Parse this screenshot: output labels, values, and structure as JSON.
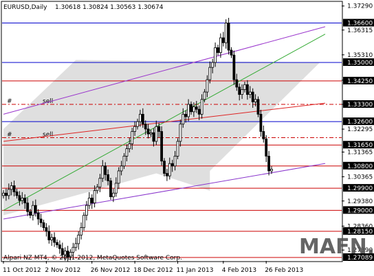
{
  "header": {
    "symbol_label": "EURUSD,Daily",
    "ohlc_label": "1.30618 1.30824 1.30563 1.30674"
  },
  "footer": {
    "copyright": "Alpari NZ MT4, © 2001-2012, MetaQuotes Software Corp.",
    "watermark": "MAFN.RU"
  },
  "colors": {
    "background": "#ffffff",
    "candles": "#000000",
    "channel_fill": "#d9d9d9",
    "level_blue": "#0000cc",
    "level_red": "#cc0000",
    "level_label_bg": "#000000",
    "resistance_purple": "#9933cc",
    "support_purple": "#8833cc",
    "trend_green": "#33aa33",
    "trend_red": "#dd2222",
    "watermark": "#555555"
  },
  "chart_data": {
    "type": "candlestick",
    "title": "EURUSD,Daily",
    "ylim": [
      1.2695,
      1.3745
    ],
    "y_ticks": [
      "1.37290",
      "1.36315",
      "1.35310",
      "1.34280",
      "1.33300",
      "1.32295",
      "1.31365",
      "1.30365",
      "1.29380",
      "1.28360",
      "1.27390"
    ],
    "x_ticks": [
      "11 Oct 2012",
      "2 Nov 2012",
      "26 Nov 2012",
      "18 Dec 2012",
      "11 Jan 2013",
      "4 Feb 2013",
      "26 Feb 2013"
    ],
    "x_tick_bars": [
      0,
      16,
      33,
      49,
      65,
      82,
      98
    ],
    "levels": [
      {
        "value": 1.366,
        "label": "1.36600",
        "color": "#0000cc",
        "style": "solid"
      },
      {
        "value": 1.35,
        "label": "1.35000",
        "color": "#0000cc",
        "style": "solid"
      },
      {
        "value": 1.3425,
        "label": "1.34250",
        "color": "#cc0000",
        "style": "solid"
      },
      {
        "value": 1.333,
        "label": "1.33300",
        "color": "#cc0000",
        "style": "dashdot",
        "marker": "#",
        "note": "sell"
      },
      {
        "value": 1.326,
        "label": "1.32600",
        "color": "#0000cc",
        "style": "solid"
      },
      {
        "value": 1.3195,
        "label": "",
        "color": "#cc0000",
        "style": "dashdot",
        "marker": "#",
        "note": "sell"
      },
      {
        "value": 1.3165,
        "label": "1.31650",
        "color": "#cc0000",
        "style": "solid"
      },
      {
        "value": 1.308,
        "label": "1.30800",
        "color": "#cc0000",
        "style": "solid"
      },
      {
        "value": 1.299,
        "label": "1.29900",
        "color": "#cc0000",
        "style": "solid"
      },
      {
        "value": 1.29,
        "label": "1.29000",
        "color": "#cc0000",
        "style": "solid"
      },
      {
        "value": 1.2815,
        "label": "1.28150",
        "color": "#cc0000",
        "style": "solid"
      },
      {
        "value": 1.27089,
        "label": "1.27089",
        "color": "#cc0000",
        "style": "solid"
      }
    ],
    "trendlines": [
      {
        "name": "channel-upper",
        "from": [
          0,
          1.329
        ],
        "to": [
          120,
          1.3645
        ],
        "color": "#9933cc"
      },
      {
        "name": "channel-lower",
        "from": [
          0,
          1.2865
        ],
        "to": [
          120,
          1.309
        ],
        "color": "#8833cc"
      },
      {
        "name": "green-trend",
        "from": [
          0,
          1.29
        ],
        "to": [
          120,
          1.3615
        ],
        "color": "#33aa33"
      },
      {
        "name": "red-trend",
        "from": [
          0,
          1.318
        ],
        "to": [
          120,
          1.3335
        ],
        "color": "#dd2222"
      }
    ],
    "channel_band": [
      [
        0,
        1.288
      ],
      [
        0,
        1.323
      ],
      [
        27,
        1.351
      ],
      [
        118,
        1.35
      ],
      [
        77,
        1.306
      ],
      [
        77,
        1.298
      ],
      [
        57,
        1.305
      ]
    ],
    "closes": [
      1.297,
      1.296,
      1.2985,
      1.3,
      1.2975,
      1.296,
      1.294,
      1.295,
      1.293,
      1.2895,
      1.288,
      1.292,
      1.289,
      1.2865,
      1.285,
      1.283,
      1.2815,
      1.278,
      1.279,
      1.277,
      1.276,
      1.2745,
      1.272,
      1.2735,
      1.271,
      1.273,
      1.275,
      1.2765,
      1.28,
      1.283,
      1.288,
      1.292,
      1.295,
      1.293,
      1.298,
      1.2995,
      1.303,
      1.308,
      1.3045,
      1.302,
      1.2955,
      1.297,
      1.301,
      1.306,
      1.308,
      1.312,
      1.315,
      1.317,
      1.322,
      1.324,
      1.326,
      1.329,
      1.325,
      1.323,
      1.321,
      1.3215,
      1.318,
      1.324,
      1.322,
      1.31,
      1.305,
      1.304,
      1.309,
      1.308,
      1.312,
      1.318,
      1.325,
      1.329,
      1.328,
      1.333,
      1.33,
      1.332,
      1.331,
      1.329,
      1.335,
      1.338,
      1.343,
      1.348,
      1.35,
      1.356,
      1.354,
      1.36,
      1.358,
      1.366,
      1.355,
      1.353,
      1.343,
      1.34,
      1.337,
      1.339,
      1.341,
      1.337,
      1.338,
      1.334,
      1.335,
      1.329,
      1.322,
      1.319,
      1.312,
      1.306,
      1.3067
    ]
  }
}
